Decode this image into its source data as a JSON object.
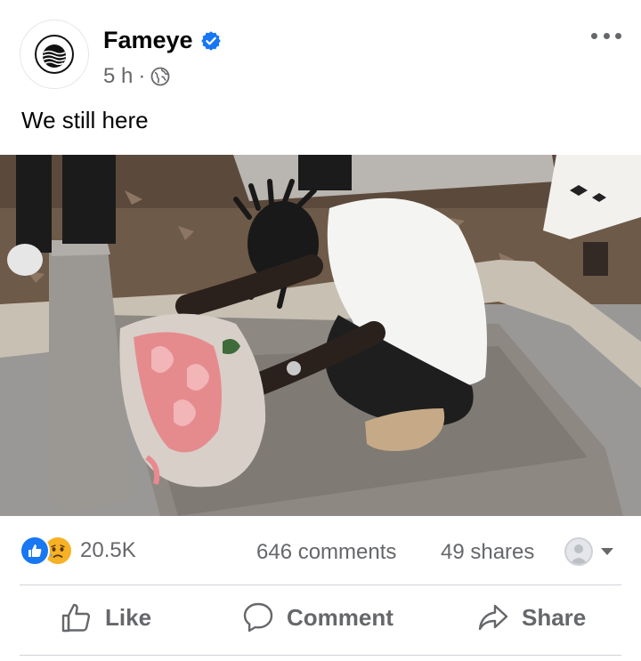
{
  "post": {
    "author": "Fameye",
    "time": "5 h",
    "dot": "·",
    "caption": "We still here"
  },
  "stats": {
    "reaction_count": "20.5K",
    "comments": "646 comments",
    "shares": "49 shares"
  },
  "actions": {
    "like": "Like",
    "comment": "Comment",
    "share": "Share"
  },
  "icons": {
    "verified": "verified-badge-icon",
    "globe": "globe-icon",
    "more": "more-options-icon",
    "like_reaction": "thumbs-up-reaction-icon",
    "sad_reaction": "sad-reaction-icon",
    "like": "thumbs-up-icon",
    "comment": "speech-bubble-icon",
    "share": "share-arrow-icon",
    "dropdown": "caret-down-icon"
  },
  "colors": {
    "verified": "#1877f2",
    "secondary_text": "#65676b",
    "like_reaction": "#1877f2",
    "sad_reaction": "#f7b125"
  }
}
